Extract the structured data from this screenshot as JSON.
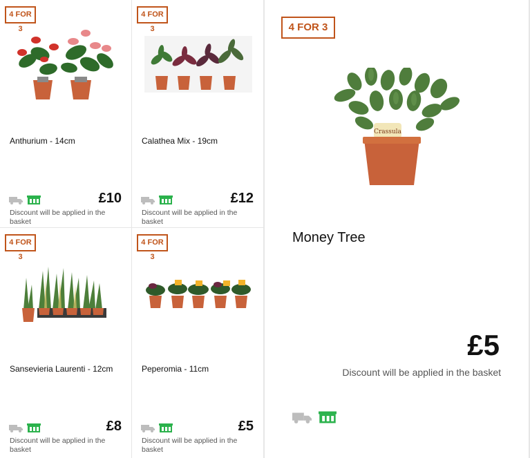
{
  "products": [
    {
      "badge": "4 FOR 3",
      "name": "Anthurium - 14cm",
      "price": "£10",
      "note": "Discount will be applied in the basket"
    },
    {
      "badge": "4 FOR 3",
      "name": "Calathea Mix - 19cm",
      "price": "£12",
      "note": "Discount will be applied in the basket"
    },
    {
      "badge": "4 FOR 3",
      "name": "Sansevieria Laurenti - 12cm",
      "price": "£8",
      "note": "Discount will be applied in the basket"
    },
    {
      "badge": "4 FOR 3",
      "name": "Peperomia - 11cm",
      "price": "£5",
      "note": "Discount will be applied in the basket"
    }
  ],
  "featured": {
    "badge": "4 FOR 3",
    "name": "Money Tree",
    "price": "£5",
    "note": "Discount will be applied in the basket",
    "pot_label": "Crassula"
  },
  "icons": {
    "delivery": "delivery-truck-icon",
    "collect": "click-and-collect-icon"
  },
  "colors": {
    "badge": "#c0541a",
    "collect": "#2bb24c",
    "truck": "#bdbdbd",
    "pot": "#c8623a"
  }
}
